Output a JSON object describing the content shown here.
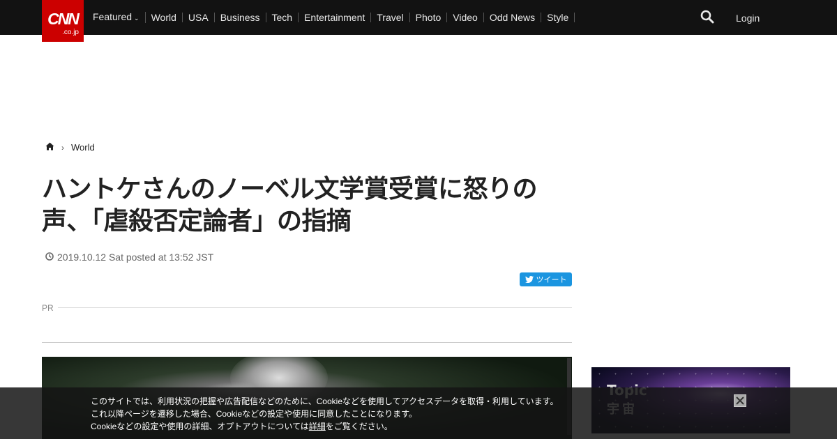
{
  "logo": {
    "main": "CNN",
    "sub": ".co.jp",
    "color": "#cc0000"
  },
  "nav": {
    "items": [
      {
        "label": "Featured",
        "has_dropdown": true
      },
      {
        "label": "World"
      },
      {
        "label": "USA"
      },
      {
        "label": "Business"
      },
      {
        "label": "Tech"
      },
      {
        "label": "Entertainment"
      },
      {
        "label": "Travel"
      },
      {
        "label": "Photo"
      },
      {
        "label": "Video"
      },
      {
        "label": "Odd News"
      },
      {
        "label": "Style"
      }
    ],
    "search_icon": "search-icon",
    "login_label": "Login"
  },
  "breadcrumb": {
    "home_icon": "home-icon",
    "current": "World"
  },
  "article": {
    "title": "ハントケさんのノーベル文学賞受賞に怒りの声、「虐殺否定論者」の指摘",
    "posted": "2019.10.12 Sat posted at 13:52 JST",
    "tweet_label": "ツイート",
    "pr_label": "PR"
  },
  "promo": {
    "topic": "Topic",
    "subject": "宇宙"
  },
  "cookie_banner": {
    "line1": "このサイトでは、利用状況の把握や広告配信などのために、Cookieなどを使用してアクセスデータを取得・利用しています。",
    "line2": "これ以降ページを遷移した場合、Cookieなどの設定や使用に同意したことになります。",
    "line3_before": "Cookieなどの設定や使用の詳細、オプトアウトについては",
    "line3_link": "詳細",
    "line3_after": "をご覧ください。",
    "close_icon": "close-icon"
  },
  "colors": {
    "topbar": "#121212",
    "accent": "#cc0000",
    "tweet": "#1b95e0"
  }
}
